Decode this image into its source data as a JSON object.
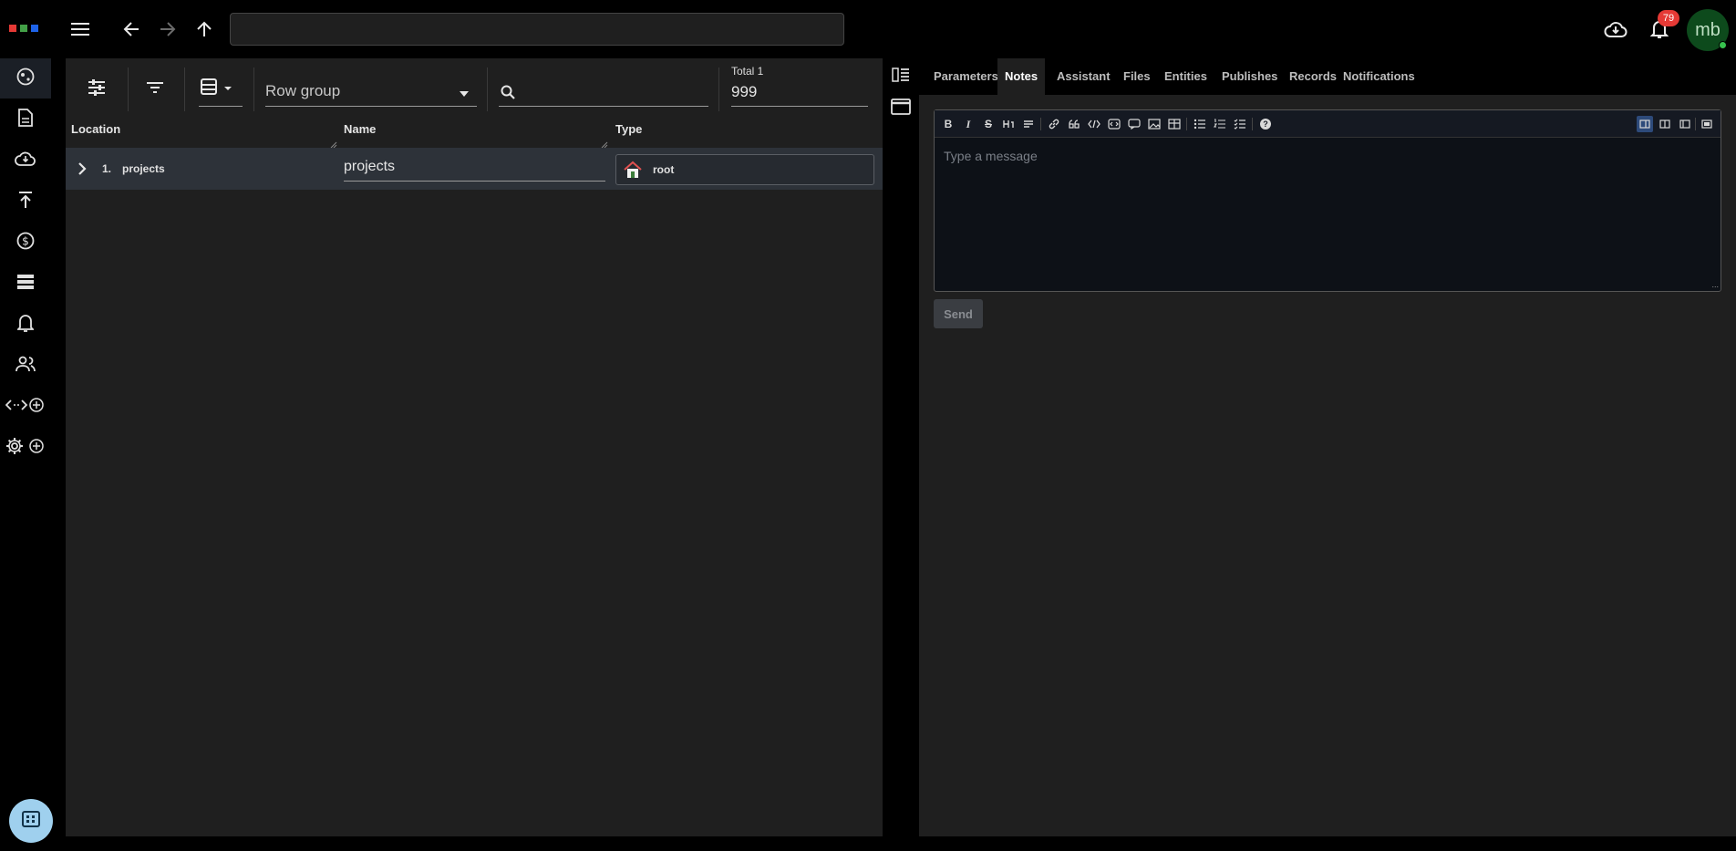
{
  "app": {
    "logo_colors": [
      "#e53935",
      "#43a047",
      "#1e63e9"
    ]
  },
  "topbar": {
    "address_value": "",
    "notification_count": "79",
    "avatar_initials": "mb"
  },
  "sidebar": {
    "items": [
      {
        "name": "projects-nav",
        "icon": "globe-icon"
      },
      {
        "name": "documents-nav",
        "icon": "document-icon"
      },
      {
        "name": "cloud-nav",
        "icon": "cloud-download-icon"
      },
      {
        "name": "publish-nav",
        "icon": "upload-icon"
      },
      {
        "name": "billing-nav",
        "icon": "dollar-icon"
      },
      {
        "name": "storage-nav",
        "icon": "storage-icon"
      },
      {
        "name": "notifications-nav",
        "icon": "bell-icon"
      },
      {
        "name": "users-nav",
        "icon": "users-icon"
      },
      {
        "name": "api-nav",
        "icon": "code-add-icon"
      },
      {
        "name": "settings-nav",
        "icon": "gear-add-icon"
      }
    ]
  },
  "grid": {
    "row_group_label": "Row group",
    "search_value": "",
    "total_label": "Total 1",
    "total_value": "999",
    "columns": [
      "Location",
      "Name",
      "Type"
    ],
    "rows": [
      {
        "index": "1.",
        "location": "projects",
        "name": "projects",
        "type": "root"
      }
    ]
  },
  "panel": {
    "tabs": [
      "Parameters",
      "Notes",
      "Assistant",
      "Files",
      "Entities",
      "Publishes",
      "Records",
      "Notifications"
    ],
    "active_tab": "Notes",
    "editor_placeholder": "Type a message",
    "editor_toolbar": {
      "bold": "B",
      "italic": "I",
      "strike": "S",
      "help": "?"
    },
    "send_label": "Send"
  },
  "colors": {
    "accent_fab": "#9fd0ee",
    "badge": "#e53935",
    "avatar": "#0d4a1c"
  }
}
